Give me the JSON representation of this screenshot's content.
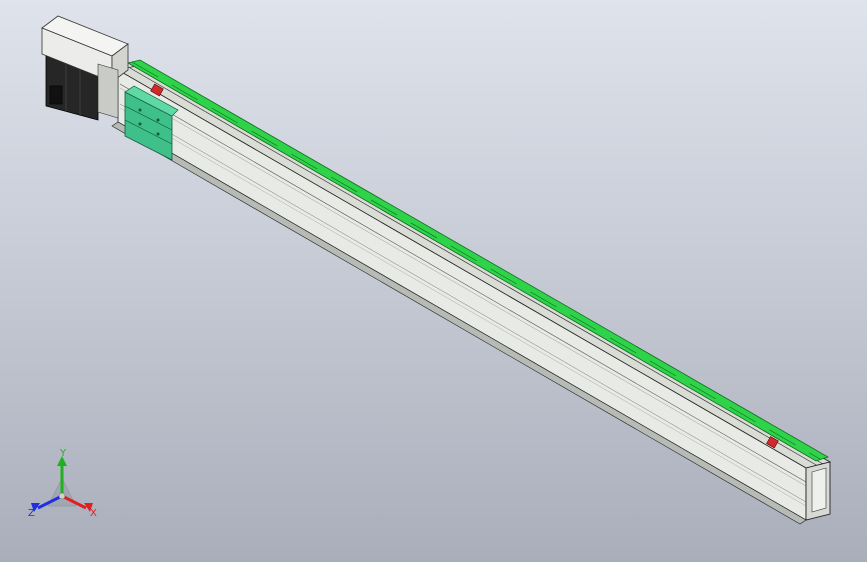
{
  "viewport": {
    "background_top": "#dfe3ec",
    "background_bottom": "#a9aebb"
  },
  "model": {
    "parts": [
      "motor-cover",
      "servo-motor",
      "linear-rail-body",
      "green-guide-rail",
      "slider-carriage",
      "red-limit-sensor",
      "end-cap"
    ],
    "colors": {
      "rail_body": "#e6e9e4",
      "rail_shadow": "#a9ada7",
      "guide": "#2fd34a",
      "carriage": "#3fbf8a",
      "sensor": "#d22a2a",
      "motor": "#2a2a2a",
      "cover": "#ececec"
    }
  },
  "triad": {
    "x_label": "X",
    "y_label": "Y",
    "z_label": "Z",
    "x_color": "#e02020",
    "y_color": "#20b020",
    "z_color": "#2030e0"
  }
}
